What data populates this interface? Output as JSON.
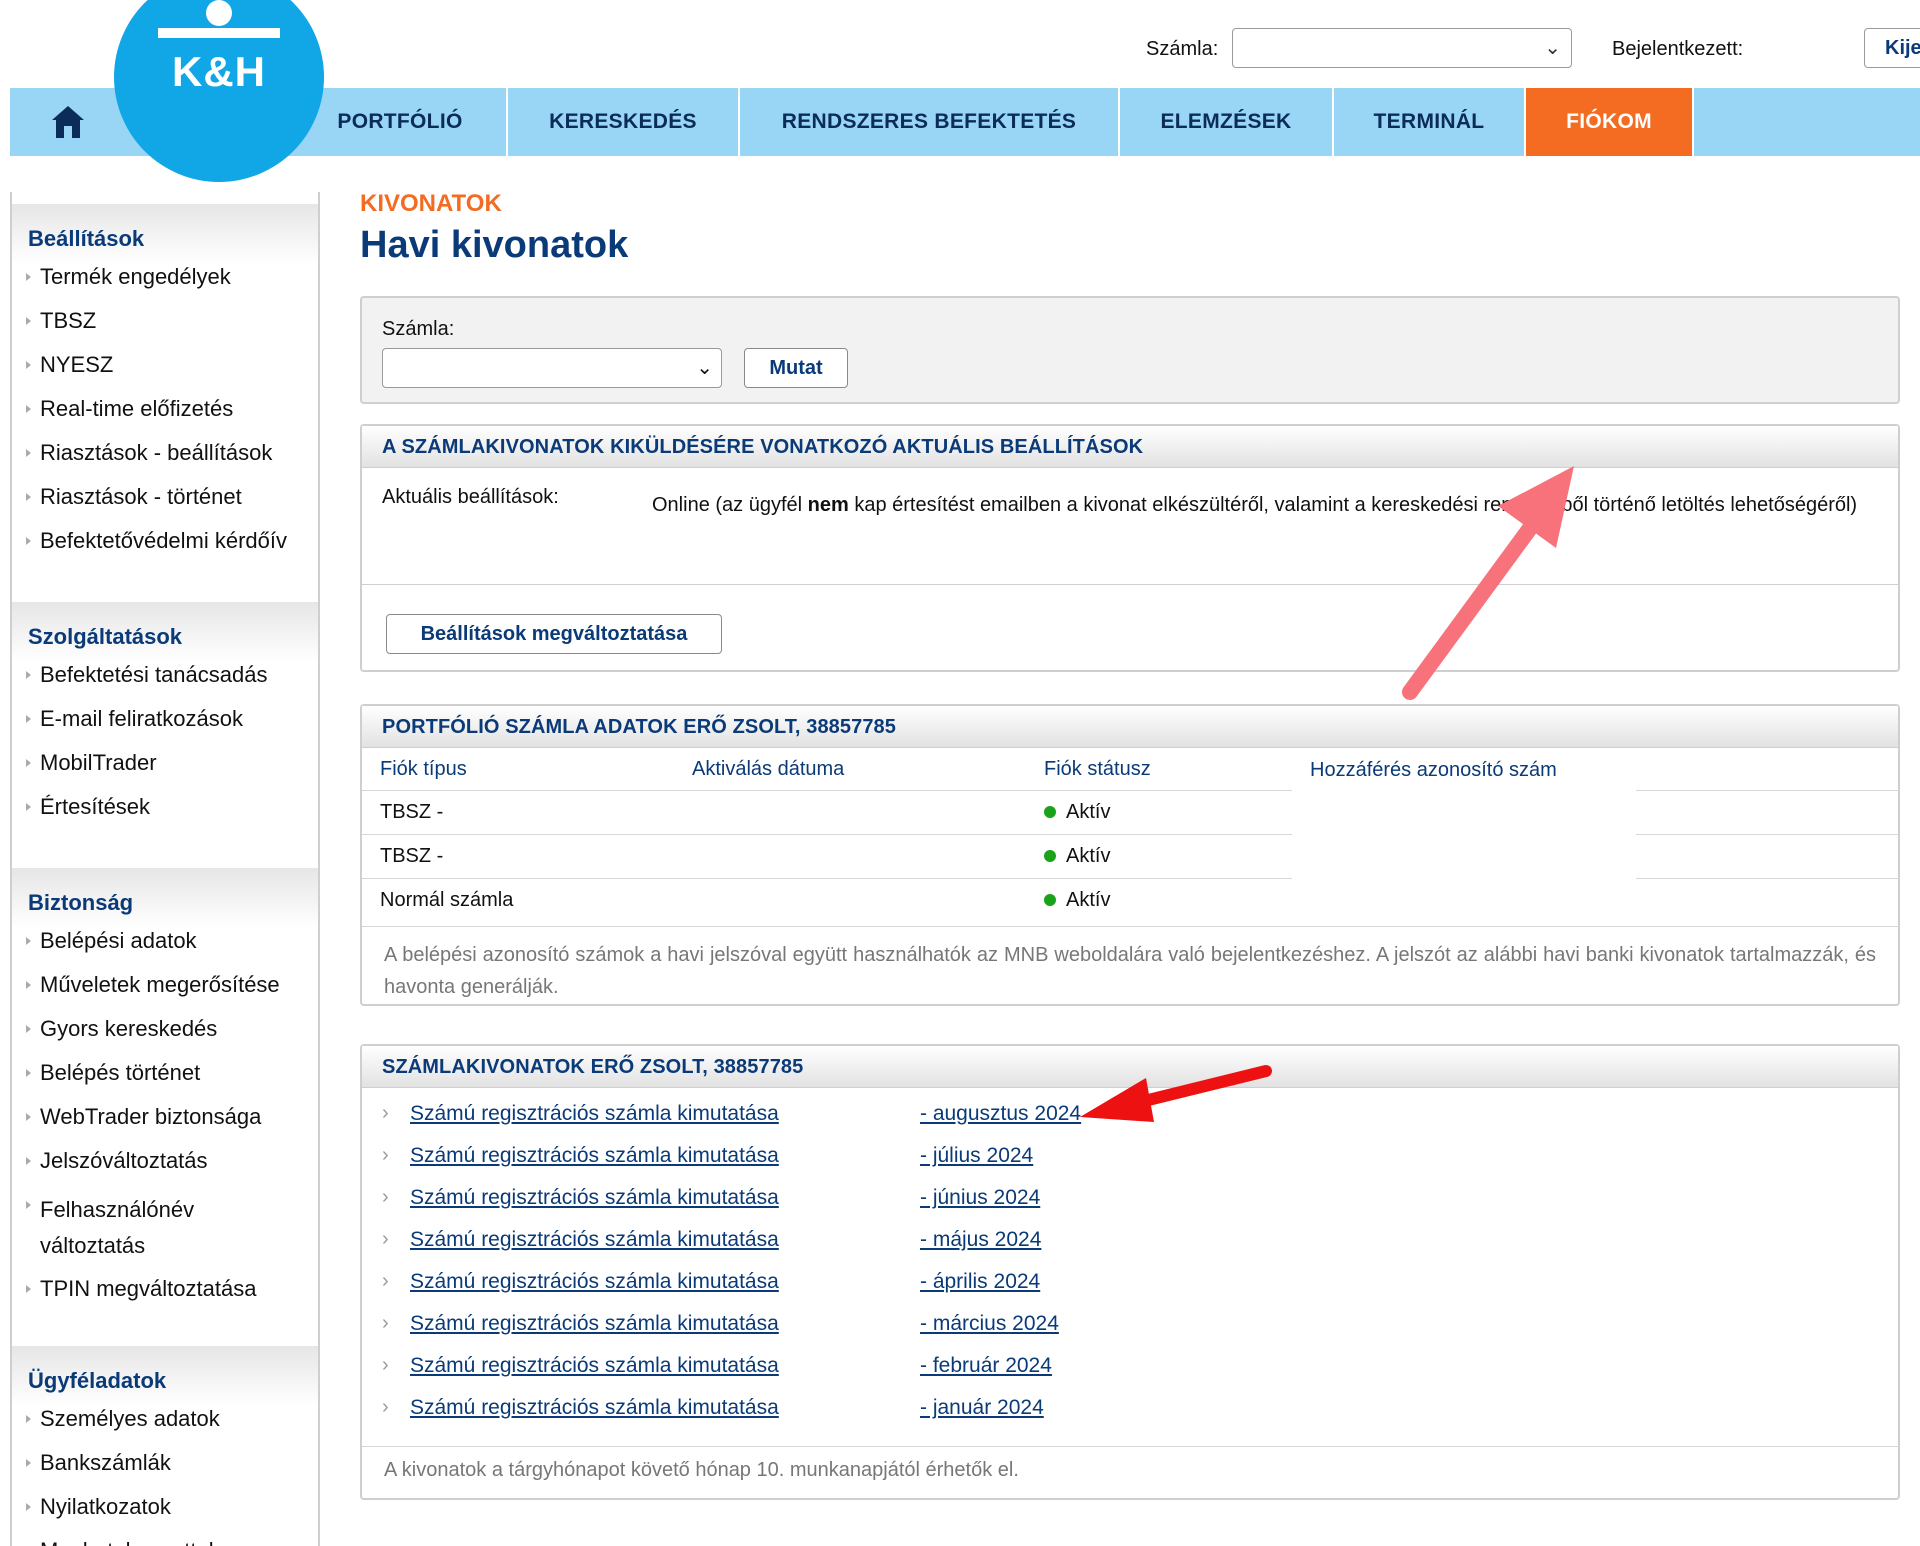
{
  "header": {
    "account_label": "Számla:",
    "logged_in_label": "Bejelentkezett:",
    "logout_label": "Kijelentkezés"
  },
  "logo": {
    "text": "K&H",
    "color": "#11a6e5"
  },
  "nav": {
    "home_icon": "home-icon",
    "items": [
      {
        "label": "PORTFÓLIÓ"
      },
      {
        "label": "KERESKEDÉS"
      },
      {
        "label": "RENDSZERES BEFEKTETÉS"
      },
      {
        "label": "ELEMZÉSEK"
      },
      {
        "label": "TERMINÁL"
      },
      {
        "label": "FIÓKOM",
        "active": true
      }
    ],
    "accent_color": "#f36c21",
    "bar_color": "#99d6f5"
  },
  "sidebar": {
    "sections": [
      {
        "title": "Beállítások",
        "items": [
          "Termék engedélyek",
          "TBSZ",
          "NYESZ",
          "Real-time előfizetés",
          "Riasztások - beállítások",
          "Riasztások - történet",
          "Befektetővédelmi kérdőív"
        ]
      },
      {
        "title": "Szolgáltatások",
        "items": [
          "Befektetési tanácsadás",
          "E-mail feliratkozások",
          "MobilTrader",
          "Értesítések"
        ]
      },
      {
        "title": "Biztonság",
        "items": [
          "Belépési adatok",
          "Műveletek megerősítése",
          "Gyors kereskedés",
          "Belépés történet",
          "WebTrader biztonsága",
          "Jelszóváltoztatás",
          "Felhasználónév változtatás",
          "TPIN megváltoztatása"
        ]
      },
      {
        "title": "Ügyféladatok",
        "items": [
          "Személyes adatok",
          "Bankszámlák",
          "Nyilatkozatok",
          "Meghatalmazottak"
        ]
      }
    ]
  },
  "main": {
    "kicker": "KIVONATOK",
    "title": "Havi kivonatok",
    "filter": {
      "label": "Számla:",
      "button": "Mutat"
    },
    "settings": {
      "heading": "A SZÁMLAKIVONATOK KIKÜLDÉSÉRE VONATKOZÓ AKTUÁLIS BEÁLLÍTÁSOK",
      "label": "Aktuális beállítások:",
      "text_before": "Online (az ügyfél ",
      "text_bold": "nem",
      "text_after": " kap értesítést emailben a kivonat elkészültéről, valamint a kereskedési rendszerből történő letöltés lehetőségéről)",
      "button": "Beállítások megváltoztatása"
    },
    "accounts": {
      "heading": "PORTFÓLIÓ SZÁMLA ADATOK ERŐ ZSOLT, 38857785",
      "columns": [
        "Fiók típus",
        "Aktiválás dátuma",
        "Fiók státusz",
        "Hozzáférés azonosító szám"
      ],
      "rows": [
        {
          "type": "TBSZ -",
          "status": "Aktív"
        },
        {
          "type": "TBSZ -",
          "status": "Aktív"
        },
        {
          "type": "Normál számla",
          "status": "Aktív"
        }
      ],
      "note": "A belépési azonosító számok a havi jelszóval együtt használhatók az MNB weboldalára való bejelentkezéshez. A jelszót az alábbi havi banki kivonatok tartalmazzák, és havonta generálják."
    },
    "statements": {
      "heading": "SZÁMLAKIVONATOK ERŐ ZSOLT, 38857785",
      "items": [
        {
          "desc": "Számú regisztrációs számla kimutatása",
          "month": "- augusztus 2024"
        },
        {
          "desc": "Számú regisztrációs számla kimutatása",
          "month": "- július 2024"
        },
        {
          "desc": "Számú regisztrációs számla kimutatása",
          "month": "- június 2024"
        },
        {
          "desc": "Számú regisztrációs számla kimutatása",
          "month": "- május 2024"
        },
        {
          "desc": "Számú regisztrációs számla kimutatása",
          "month": "- április 2024"
        },
        {
          "desc": "Számú regisztrációs számla kimutatása",
          "month": "- március 2024"
        },
        {
          "desc": "Számú regisztrációs számla kimutatása",
          "month": "- február 2024"
        },
        {
          "desc": "Számú regisztrációs számla kimutatása",
          "month": "- január 2024"
        }
      ],
      "note": "A kivonatok a tárgyhónapot követő hónap 10. munkanapjától érhetők el."
    }
  }
}
